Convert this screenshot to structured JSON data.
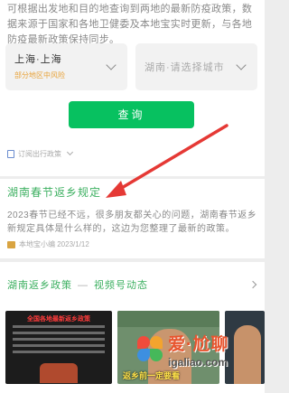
{
  "intro": {
    "text": "可根据出发地和目的地查询到两地的最新防疫政策，数据来源于国家和各地卫健委及本地宝实时更新，与各地防疫最新政策保持同步。"
  },
  "route": {
    "from_value": "上海·上海",
    "from_tag": "部分地区中风险",
    "to_value": "湖南·请选择城市"
  },
  "query_button": {
    "label": "查询"
  },
  "subscribe": {
    "label": "订阅出行政策"
  },
  "article": {
    "title": "湖南春节返乡规定",
    "body": "2023春节已经不远，很多朋友都关心的问题，湖南春节返乡新规定具体是什么样的，这边为您整理了最新的政策。",
    "meta": "本地宝小编 2023/1/12"
  },
  "video_section": {
    "title": "湖南返乡政策",
    "subtitle": "视频号动态"
  },
  "thumbnails": [
    {
      "headline": "全国各地最新返乡政策",
      "caption": ""
    },
    {
      "headline": "",
      "caption": "返乡前一定要看"
    },
    {
      "headline": "",
      "caption": ""
    }
  ],
  "watermark": {
    "brand": "爱·尬聊",
    "url": "igaliao.com"
  },
  "colors": {
    "accent_green": "#07c160",
    "arrow_red": "#e53935",
    "title_green": "#3db061"
  }
}
